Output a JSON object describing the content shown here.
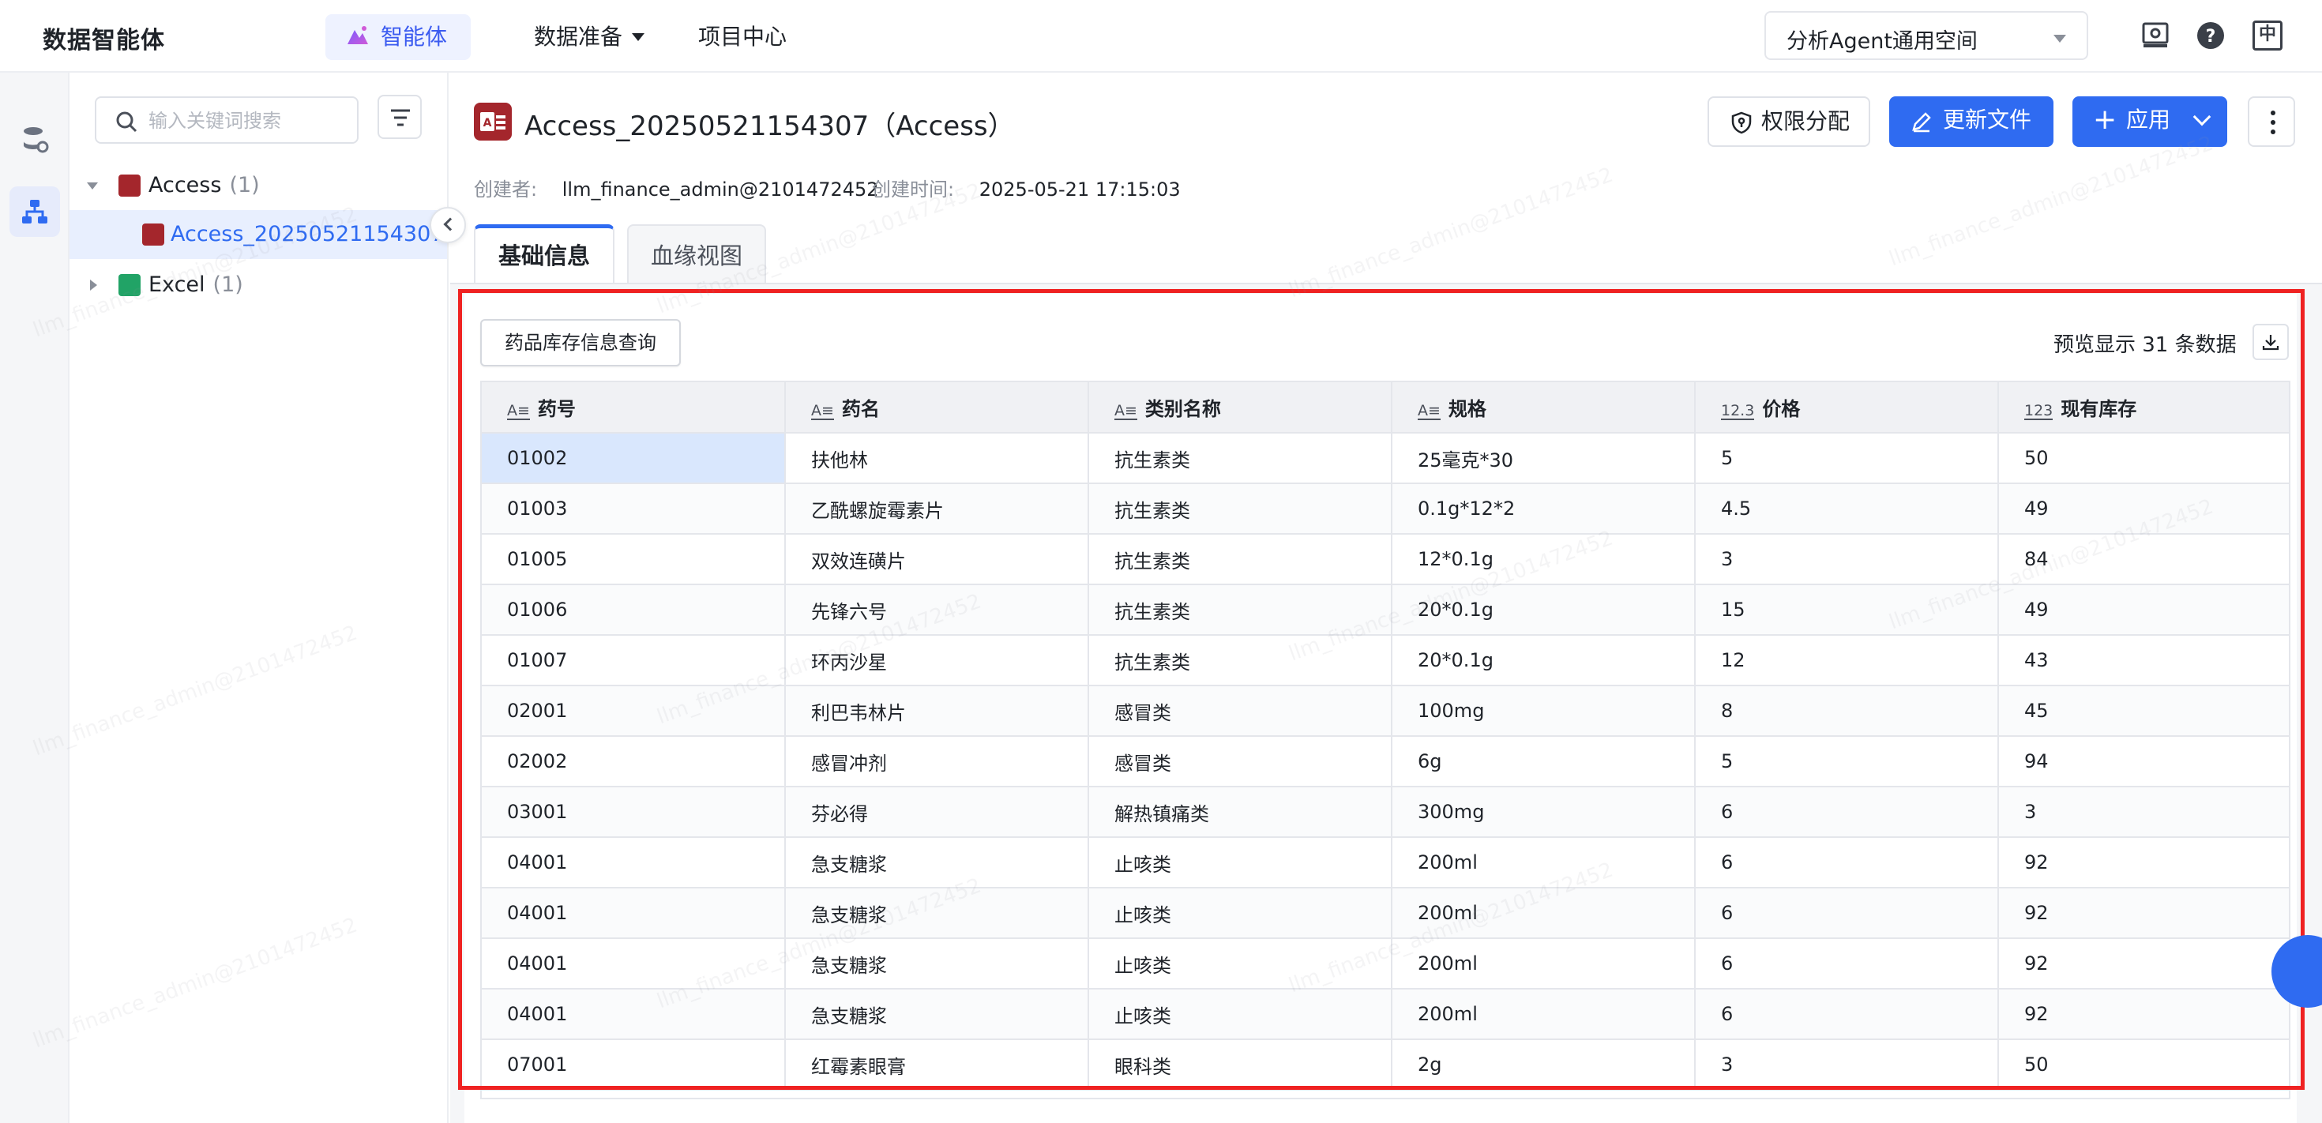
{
  "nav": {
    "app_title": "数据智能体",
    "items": [
      {
        "label": "智能体",
        "active": true
      },
      {
        "label": "数据准备",
        "has_dropdown": true
      },
      {
        "label": "项目中心"
      }
    ],
    "space_select": "分析Agent通用空间",
    "icons": [
      "settings-monitor-icon",
      "help-icon",
      "language-zh-icon"
    ],
    "lang_label": "中"
  },
  "sidebar": {
    "search_placeholder": "输入关键词搜索",
    "tree": [
      {
        "label": "Access",
        "count": "(1)",
        "expanded": true,
        "icon": "access-icon",
        "children": [
          {
            "label": "Access_20250521154307",
            "selected": true,
            "icon": "access-icon"
          }
        ]
      },
      {
        "label": "Excel",
        "count": "(1)",
        "expanded": false,
        "icon": "excel-icon"
      }
    ]
  },
  "header": {
    "title": "Access_20250521154307（Access）",
    "perm_button": "权限分配",
    "update_button": "更新文件",
    "apply_button": "应用",
    "creator_label": "创建者:",
    "creator": "llm_finance_admin@2101472452",
    "created_label": "创建时间:",
    "created_at": "2025-05-21 17:15:03"
  },
  "tabs": [
    {
      "label": "基础信息",
      "active": true
    },
    {
      "label": "血缘视图",
      "active": false
    }
  ],
  "preview": {
    "query_name": "药品库存信息查询",
    "count_text": "预览显示 31 条数据",
    "columns": [
      {
        "type": "A≡",
        "name": "药号"
      },
      {
        "type": "A≡",
        "name": "药名"
      },
      {
        "type": "A≡",
        "name": "类别名称"
      },
      {
        "type": "A≡",
        "name": "规格"
      },
      {
        "type": "12.3",
        "name": "价格"
      },
      {
        "type": "123",
        "name": "现有库存"
      }
    ],
    "rows": [
      [
        "01002",
        "扶他林",
        "抗生素类",
        "25毫克*30",
        "5",
        "50"
      ],
      [
        "01003",
        "乙酰螺旋霉素片",
        "抗生素类",
        "0.1g*12*2",
        "4.5",
        "49"
      ],
      [
        "01005",
        "双效连磺片",
        "抗生素类",
        "12*0.1g",
        "3",
        "84"
      ],
      [
        "01006",
        "先锋六号",
        "抗生素类",
        "20*0.1g",
        "15",
        "49"
      ],
      [
        "01007",
        "环丙沙星",
        "抗生素类",
        "20*0.1g",
        "12",
        "43"
      ],
      [
        "02001",
        "利巴韦林片",
        "感冒类",
        "100mg",
        "8",
        "45"
      ],
      [
        "02002",
        "感冒冲剂",
        "感冒类",
        "6g",
        "5",
        "94"
      ],
      [
        "03001",
        "芬必得",
        "解热镇痛类",
        "300mg",
        "6",
        "3"
      ],
      [
        "04001",
        "急支糖浆",
        "止咳类",
        "200ml",
        "6",
        "92"
      ],
      [
        "04001",
        "急支糖浆",
        "止咳类",
        "200ml",
        "6",
        "92"
      ],
      [
        "04001",
        "急支糖浆",
        "止咳类",
        "200ml",
        "6",
        "92"
      ],
      [
        "04001",
        "急支糖浆",
        "止咳类",
        "200ml",
        "6",
        "92"
      ],
      [
        "07001",
        "红霉素眼膏",
        "眼科类",
        "2g",
        "3",
        "50"
      ]
    ]
  },
  "watermark": "llm_finance_admin@2101472452",
  "colors": {
    "accent": "#2f6bf1",
    "highlight": "#ef2222",
    "access": "#a4262c",
    "excel": "#21a366"
  }
}
